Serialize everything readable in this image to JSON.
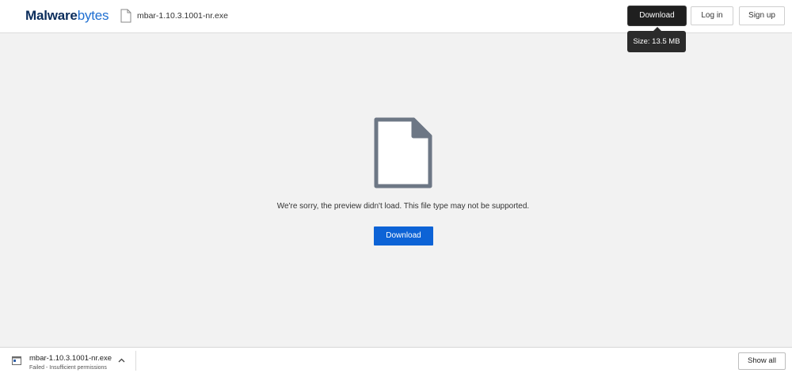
{
  "header": {
    "logo_part1": "Malware",
    "logo_part2": "bytes",
    "filename": "mbar-1.10.3.1001-nr.exe",
    "download_label": "Download",
    "login_label": "Log in",
    "signup_label": "Sign up",
    "tooltip_text": "Size: 13.5 MB"
  },
  "preview": {
    "message": "We're sorry, the preview didn't load. This file type may not be supported.",
    "download_label": "Download"
  },
  "download_shelf": {
    "file_name": "mbar-1.10.3.1001-nr.exe",
    "status": "Failed - Insufficient permissions",
    "show_all_label": "Show all"
  },
  "colors": {
    "logo_dark": "#0b2d5c",
    "logo_blue": "#1f6fd1",
    "primary_button": "#0d63d6",
    "top_download_button": "#1f1f1f",
    "background": "#f2f2f2"
  },
  "icons": {
    "header_file": "file-icon",
    "preview_file": "file-icon",
    "shelf_file": "executable-file-icon",
    "shelf_menu": "chevron-up-icon"
  }
}
